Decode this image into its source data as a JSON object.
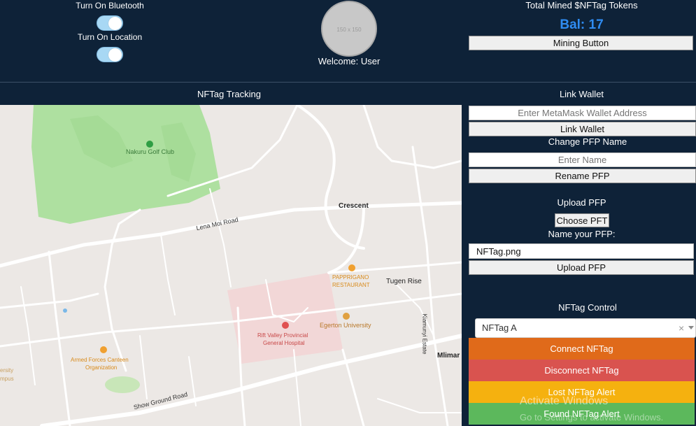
{
  "header": {
    "bluetooth_label": "Turn On Bluetooth",
    "location_label": "Turn On Location",
    "avatar_placeholder": "150 x 150",
    "welcome_text": "Welcome: User",
    "tokens_title": "Total Mined $NFTag Tokens",
    "balance": "Bal: 17",
    "mining_button": "Mining Button"
  },
  "tracking": {
    "title": "NFTag Tracking",
    "map_labels": {
      "golf_club": "Nakuru Golf Club",
      "lena_moi": "Lena Moi Road",
      "crescent": "Crescent",
      "pappriganos": "PAPPRIGANO",
      "restaurant": "RESTAURANT",
      "tugen_rise": "Tugen Rise",
      "rift_valley": "Rift Valley Provincial",
      "general_hospital": "General Hospital",
      "egerton": "Egerton University",
      "armed_forces": "Armed Forces Canteen",
      "organization": "Organization",
      "kiamunyi": "Kiamunyi Estate",
      "mlimani": "Mlimar",
      "show_ground": "Show Ground Road",
      "ersity": "ersity",
      "mpus": "mpus"
    }
  },
  "wallet": {
    "title": "Link Wallet",
    "address_placeholder": "Enter MetaMask Wallet Address",
    "link_button": "Link Wallet"
  },
  "pfp_name": {
    "title": "Change PFP Name",
    "name_placeholder": "Enter Name",
    "rename_button": "Rename PFP"
  },
  "upload": {
    "title": "Upload PFP",
    "choose_button": "Choose PFT",
    "name_label": "Name your PFP:",
    "filename_value": "NFTag.png",
    "upload_button": "Upload PFP"
  },
  "control": {
    "title": "NFTag Control",
    "selected": "NFTag A",
    "clear_symbol": "×",
    "connect": "Connect NFTag",
    "disconnect": "Disconnect NFTag",
    "lost": "Lost NFTag Alert",
    "found": "Found NFTag Alert"
  },
  "watermark": {
    "line1": "Activate Windows",
    "line2": "Go to Settings to activate Windows."
  },
  "colors": {
    "background": "#0e2238",
    "balance": "#2f8cf2",
    "connect": "#e06a1a",
    "disconnect": "#d9534f",
    "lost": "#f5b10f",
    "found": "#5cb85c"
  }
}
